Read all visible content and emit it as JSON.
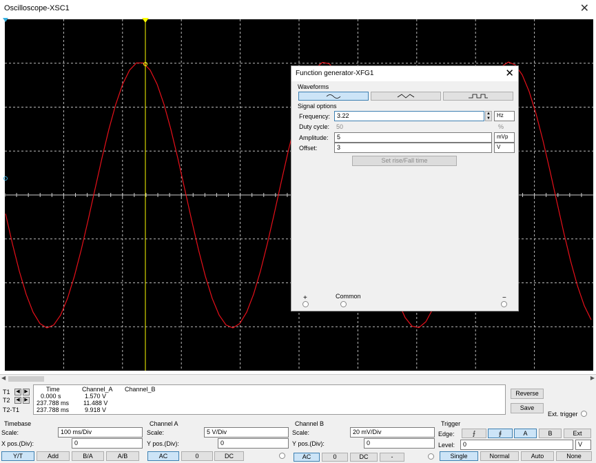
{
  "window": {
    "title": "Oscilloscope-XSC1",
    "close_glyph": "✕"
  },
  "readout": {
    "headers": {
      "time": "Time",
      "channel_a": "Channel_A",
      "channel_b": "Channel_B"
    },
    "rows": [
      {
        "label": "T1",
        "time": "0.000 s",
        "channel_a": "1.570 V"
      },
      {
        "label": "T2",
        "time": "237.788 ms",
        "channel_a": "11.488 V"
      },
      {
        "label": "T2-T1",
        "time": "237.788 ms",
        "channel_a": "9.918 V"
      }
    ],
    "reverse": "Reverse",
    "save": "Save",
    "ext_trigger": "Ext. trigger"
  },
  "timebase": {
    "title": "Timebase",
    "scale_label": "Scale:",
    "scale": "100 ms/Div",
    "xpos_label": "X pos.(Div):",
    "xpos": "0",
    "buttons": [
      "Y/T",
      "Add",
      "B/A",
      "A/B"
    ]
  },
  "channel_a": {
    "title": "Channel A",
    "scale_label": "Scale:",
    "scale": "5  V/Div",
    "ypos_label": "Y pos.(Div):",
    "ypos": "0",
    "buttons": [
      "AC",
      "0",
      "DC"
    ]
  },
  "channel_b": {
    "title": "Channel B",
    "scale_label": "Scale:",
    "scale": "20 mV/Div",
    "ypos_label": "Y pos.(Div):",
    "ypos": "0",
    "buttons": [
      "AC",
      "0",
      "DC",
      "-"
    ]
  },
  "trigger": {
    "title": "Trigger",
    "edge_label": "Edge:",
    "edge_buttons": [
      "A",
      "B",
      "Ext"
    ],
    "level_label": "Level:",
    "level": "0",
    "level_unit": "V",
    "modes": [
      "Single",
      "Normal",
      "Auto",
      "None"
    ]
  },
  "function_generator": {
    "title": "Function generator-XFG1",
    "waveforms_label": "Waveforms",
    "signal_options_label": "Signal options",
    "frequency_label": "Frequency:",
    "frequency": "3.22",
    "frequency_unit": "Hz",
    "duty_label": "Duty cycle:",
    "duty": "50",
    "duty_unit": "%",
    "amplitude_label": "Amplitude:",
    "amplitude": "5",
    "amplitude_unit": "mVp",
    "offset_label": "Offset:",
    "offset": "3",
    "offset_unit": "V",
    "rise_fall_button": "Set rise/Fall time",
    "plus": "+",
    "common": "Common",
    "minus": "−"
  },
  "colors": {
    "screen": "#000000",
    "grid": "#bdbdbd",
    "trace_a": "#e8101a",
    "cursor": "#ffff00"
  }
}
